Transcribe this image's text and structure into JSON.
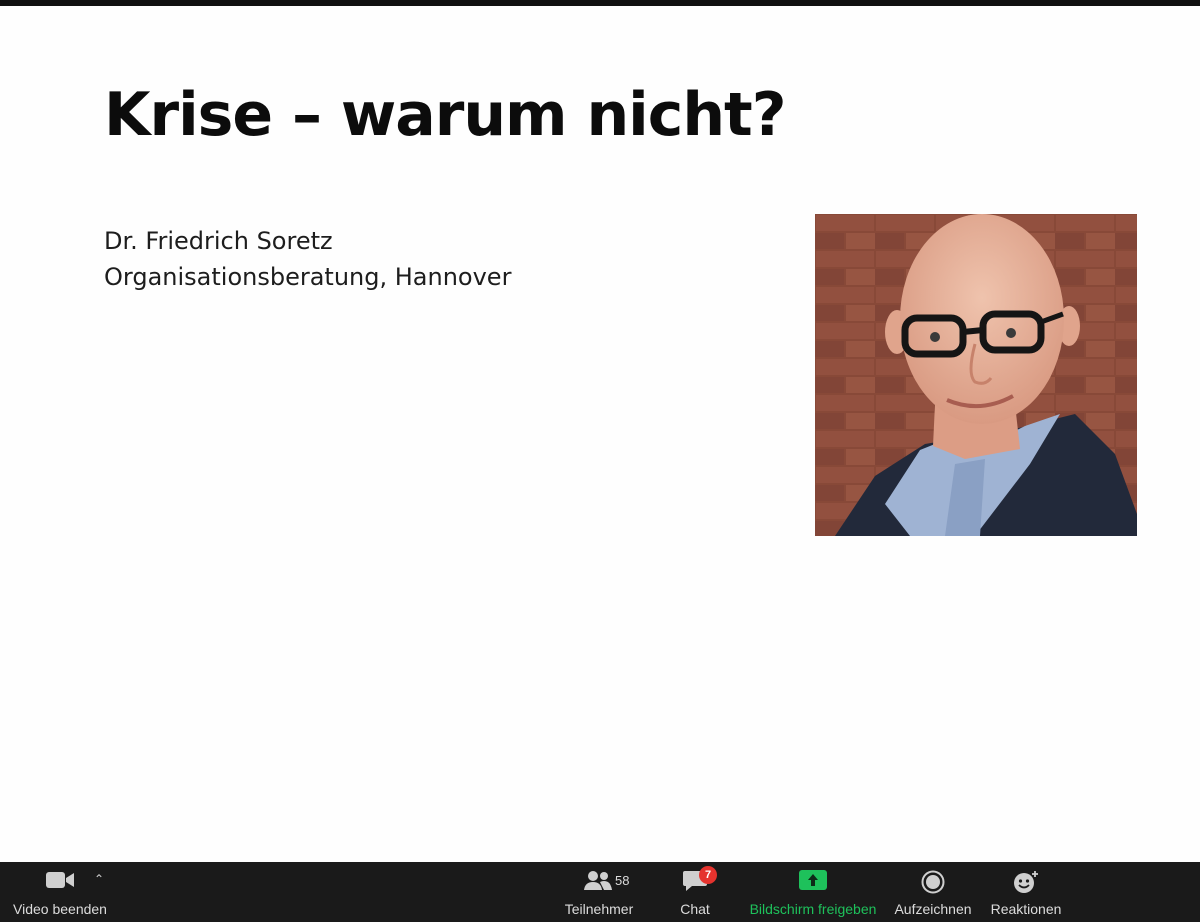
{
  "slide": {
    "title": "Krise – warum nicht?",
    "name": "Dr. Friedrich Soretz",
    "organization": "Organisationsberatung, Hannover"
  },
  "toolbar": {
    "video_label": "Video beenden",
    "participants_label": "Teilnehmer",
    "participants_count": "58",
    "chat_label": "Chat",
    "chat_badge": "7",
    "share_label": "Bildschirm freigeben",
    "record_label": "Aufzeichnen",
    "reactions_label": "Reaktionen"
  },
  "colors": {
    "toolbar_bg": "#1a1a1a",
    "share_accent": "#1ec15b",
    "badge": "#e5332e"
  },
  "icons": [
    "video-camera-icon",
    "caret-up-icon",
    "participants-icon",
    "chat-bubble-icon",
    "share-screen-icon",
    "record-icon",
    "reactions-icon"
  ]
}
